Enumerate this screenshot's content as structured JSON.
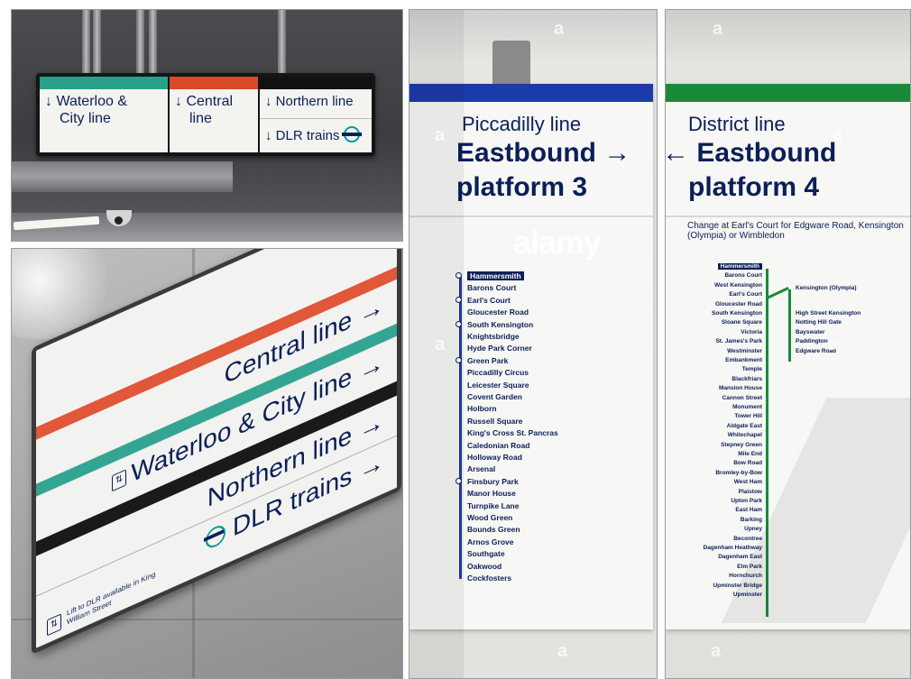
{
  "panel_a": {
    "segments": [
      {
        "line1": "↓ Waterloo &",
        "line2": "City line",
        "color": "#27a18a"
      },
      {
        "line1": "↓ Central",
        "line2": "line",
        "color": "#d94a2a"
      },
      {
        "line1": "↓ Northern line",
        "line2": "↓ DLR trains",
        "color": "#111111"
      }
    ]
  },
  "panel_b": {
    "rows": [
      "Central line →",
      "Waterloo & City line →",
      "Northern line →",
      "DLR trains →"
    ],
    "note": "Lift to DLR available in King William Street",
    "colors": {
      "central": "#e0573a",
      "waterloo": "#34a592",
      "northern": "#1a1a1a",
      "dlr": "#009999"
    }
  },
  "panel_c": {
    "line_name": "Piccadilly line",
    "direction": "Eastbound →",
    "platform": "platform 3",
    "band_color": "#1c3aa9",
    "stations": [
      "Hammersmith",
      "Barons Court",
      "Earl's Court",
      "Gloucester Road",
      "South Kensington",
      "Knightsbridge",
      "Hyde Park Corner",
      "Green Park",
      "Piccadilly Circus",
      "Leicester Square",
      "Covent Garden",
      "Holborn",
      "Russell Square",
      "King's Cross St. Pancras",
      "Caledonian Road",
      "Holloway Road",
      "Arsenal",
      "Finsbury Park",
      "Manor House",
      "Turnpike Lane",
      "Wood Green",
      "Bounds Green",
      "Arnos Grove",
      "Southgate",
      "Oakwood",
      "Cockfosters"
    ]
  },
  "panel_d": {
    "line_name": "District line",
    "direction": "← Eastbound",
    "platform": "platform 4",
    "band_color": "#1a8a3a",
    "change_note": "Change at Earl's Court for Edgware Road, Kensington (Olympia) or Wimbledon",
    "stations": [
      "Hammersmith",
      "Barons Court",
      "West Kensington",
      "Earl's Court",
      "Gloucester Road",
      "South Kensington",
      "Sloane Square",
      "Victoria",
      "St. James's Park",
      "Westminster",
      "Embankment",
      "Temple",
      "Blackfriars",
      "Mansion House",
      "Cannon Street",
      "Monument",
      "Tower Hill",
      "Aldgate East",
      "Whitechapel",
      "Stepney Green",
      "Mile End",
      "Bow Road",
      "Bromley-by-Bow",
      "West Ham",
      "Plaistow",
      "Upton Park",
      "East Ham",
      "Barking",
      "Upney",
      "Becontree",
      "Dagenham Heathway",
      "Dagenham East",
      "Elm Park",
      "Hornchurch",
      "Upminster Bridge",
      "Upminster"
    ],
    "branch": [
      "Kensington (Olympia)",
      "High Street Kensington",
      "Notting Hill Gate",
      "Bayswater",
      "Paddington",
      "Edgware Road"
    ]
  },
  "watermarks": {
    "letter": "a",
    "word": "alamy"
  }
}
